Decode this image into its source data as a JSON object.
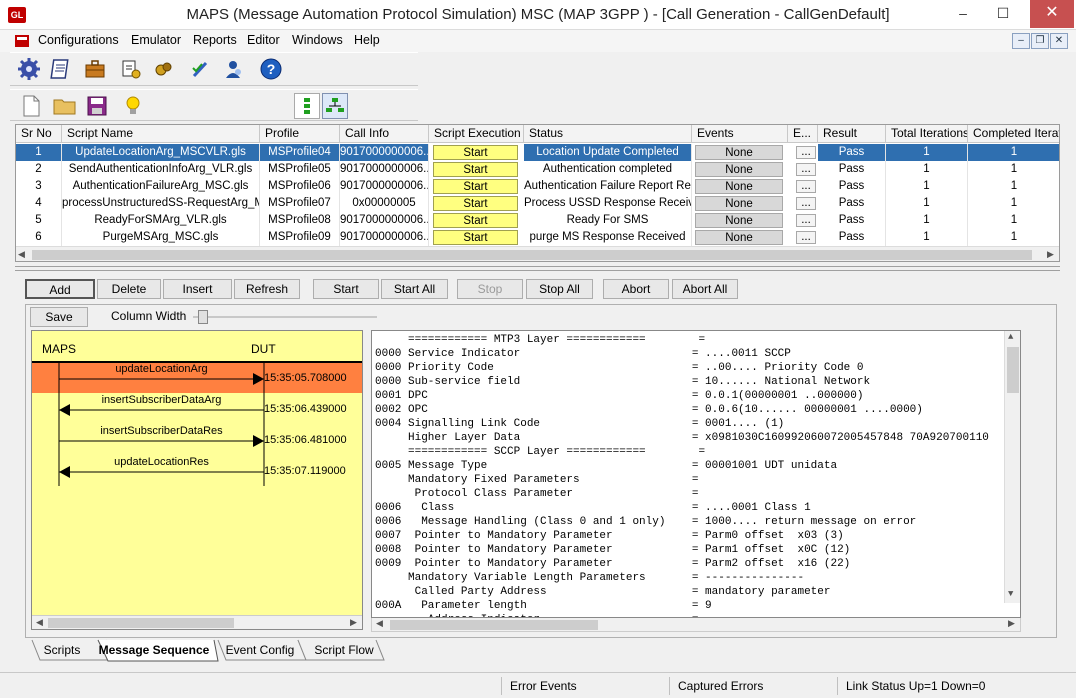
{
  "window": {
    "title": "MAPS (Message Automation Protocol Simulation) MSC (MAP 3GPP ) - [Call Generation - CallGenDefault]",
    "app_icon_text": "GL",
    "minimize": "–",
    "maximize": "☐",
    "close": "✕"
  },
  "menu": [
    "Configurations",
    "Emulator",
    "Reports",
    "Editor",
    "Windows",
    "Help"
  ],
  "mdi_controls": {
    "minimize": "–",
    "restore": "❐",
    "close": "✕"
  },
  "grid": {
    "columns": [
      "Sr No",
      "Script Name",
      "Profile",
      "Call Info",
      "Script Execution",
      "Status",
      "Events",
      "E...",
      "Result",
      "Total Iterations",
      "Completed Iteratio"
    ],
    "rows": [
      {
        "sr": "1",
        "script": "UpdateLocationArg_MSCVLR.gls",
        "profile": "MSProfile04",
        "callinfo": "9017000000006...",
        "exec": "Start",
        "status": "Location Update Completed",
        "events": "None",
        "e": "...",
        "result": "Pass",
        "total": "1",
        "completed": "1"
      },
      {
        "sr": "2",
        "script": "SendAuthenticationInfoArg_VLR.gls",
        "profile": "MSProfile05",
        "callinfo": "9017000000006...",
        "exec": "Start",
        "status": "Authentication completed",
        "events": "None",
        "e": "...",
        "result": "Pass",
        "total": "1",
        "completed": "1"
      },
      {
        "sr": "3",
        "script": "AuthenticationFailureArg_MSC.gls",
        "profile": "MSProfile06",
        "callinfo": "9017000000006...",
        "exec": "Start",
        "status": "Authentication Failure Report Res...",
        "events": "None",
        "e": "...",
        "result": "Pass",
        "total": "1",
        "completed": "1"
      },
      {
        "sr": "4",
        "script": "processUnstructuredSS-RequestArg_M...",
        "profile": "MSProfile07",
        "callinfo": "0x00000005",
        "exec": "Start",
        "status": "Process USSD Response Receiv...",
        "events": "None",
        "e": "...",
        "result": "Pass",
        "total": "1",
        "completed": "1"
      },
      {
        "sr": "5",
        "script": "ReadyForSMArg_VLR.gls",
        "profile": "MSProfile08",
        "callinfo": "9017000000006...",
        "exec": "Start",
        "status": "Ready For SMS",
        "events": "None",
        "e": "...",
        "result": "Pass",
        "total": "1",
        "completed": "1"
      },
      {
        "sr": "6",
        "script": "PurgeMSArg_MSC.gls",
        "profile": "MSProfile09",
        "callinfo": "9017000000006...",
        "exec": "Start",
        "status": "purge MS Response Received",
        "events": "None",
        "e": "...",
        "result": "Pass",
        "total": "1",
        "completed": "1"
      }
    ]
  },
  "actions": [
    "Add",
    "Delete",
    "Insert",
    "Refresh",
    "Start",
    "Start All",
    "Stop",
    "Stop All",
    "Abort",
    "Abort All"
  ],
  "seq_toolbar": {
    "save": "Save",
    "column_width": "Column Width"
  },
  "sequence": {
    "left_label": "MAPS",
    "right_label": "DUT",
    "messages": [
      {
        "label": "updateLocationArg",
        "time": "15:35:05.708000",
        "direction": "right",
        "highlighted": true
      },
      {
        "label": "insertSubscriberDataArg",
        "time": "15:35:06.439000",
        "direction": "left",
        "highlighted": false
      },
      {
        "label": "insertSubscriberDataRes",
        "time": "15:35:06.481000",
        "direction": "right",
        "highlighted": false
      },
      {
        "label": "updateLocationRes",
        "time": "15:35:07.119000",
        "direction": "left",
        "highlighted": false
      }
    ]
  },
  "decode_lines": [
    "     ============ MTP3 Layer ============        =",
    "0000 Service Indicator                          = ....0011 SCCP",
    "0000 Priority Code                              = ..00.... Priority Code 0",
    "0000 Sub-service field                          = 10...... National Network",
    "0001 DPC                                        = 0.0.1(00000001 ..000000)",
    "0002 OPC                                        = 0.0.6(10...... 00000001 ....0000)",
    "0004 Signalling Link Code                       = 0001.... (1)",
    "     Higher Layer Data                          = x0981030C160992060072005457848 70A920700110",
    "     ============ SCCP Layer ============        =",
    "0005 Message Type                               = 00001001 UDT unidata",
    "     Mandatory Fixed Parameters                 =",
    "      Protocol Class Parameter                  =",
    "0006   Class                                    = ....0001 Class 1",
    "0006   Message Handling (Class 0 and 1 only)    = 1000.... return message on error",
    "0007  Pointer to Mandatory Parameter            = Parm0 offset  x03 (3)",
    "0008  Pointer to Mandatory Parameter            = Parm1 offset  x0C (12)",
    "0009  Pointer to Mandatory Parameter            = Parm2 offset  x16 (22)",
    "     Mandatory Variable Length Parameters       = ---------------",
    "      Called Party Address                      = mandatory parameter",
    "000A   Parameter length                         = 9",
    "        Address Indicator                       ="
  ],
  "tabs": [
    "Scripts",
    "Message Sequence",
    "Event Config",
    "Script Flow"
  ],
  "active_tab": "Message Sequence",
  "status": [
    "Error Events",
    "Captured Errors",
    "Link Status Up=1 Down=0"
  ],
  "colors": {
    "selection": "#2f6fb0",
    "start_button": "#ffff80",
    "sequence_bg": "#ffff99",
    "highlight": "#ff8040"
  }
}
